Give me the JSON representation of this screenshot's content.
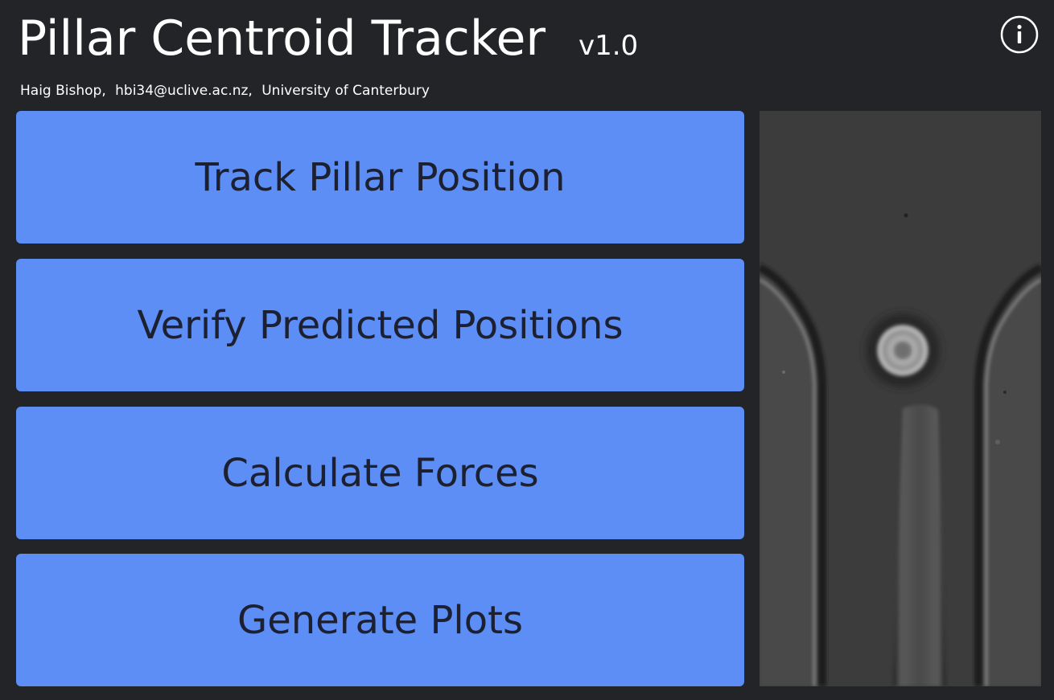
{
  "header": {
    "title": "Pillar Centroid Tracker",
    "version": "v1.0",
    "info_icon": "info-circle-icon"
  },
  "credits": {
    "author": "Haig Bishop,",
    "email": "hbi34@uclive.ac.nz,",
    "institution": "University of Canterbury"
  },
  "buttons": [
    {
      "label": "Track Pillar Position"
    },
    {
      "label": "Verify Predicted Positions"
    },
    {
      "label": "Calculate Forces"
    },
    {
      "label": "Generate Plots"
    }
  ],
  "colors": {
    "background": "#232427",
    "button": "#5c8ef5",
    "button_text": "#1c2030",
    "text": "#ffffff"
  }
}
